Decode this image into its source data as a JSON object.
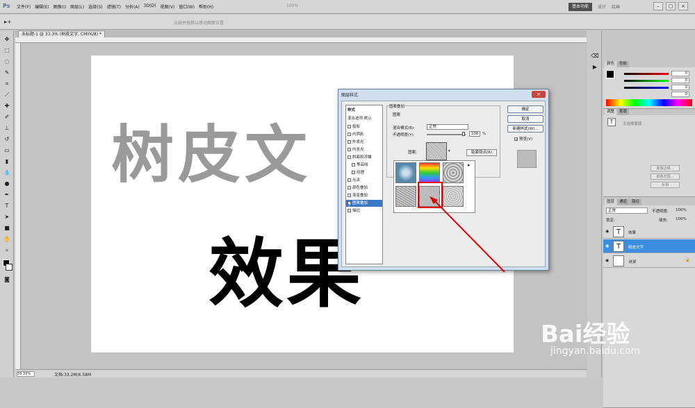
{
  "app": {
    "logo": "Ps",
    "workspace_label": "基本功能",
    "right_links": [
      "设计",
      "绘画"
    ],
    "zoom_display": "100%"
  },
  "menu": [
    "文件(F)",
    "编辑(E)",
    "图像(I)",
    "图层(L)",
    "选择(S)",
    "滤镜(T)",
    "分析(A)",
    "3D(D)",
    "视图(V)",
    "窗口(W)",
    "帮助(H)"
  ],
  "options": {
    "hint": "点按并拖移以移动图案位置"
  },
  "document": {
    "tab_title": "未标题-1 @ 33.3% (树皮文字, CMYK/8) *",
    "bark_text": "树皮文",
    "effect_text": "效果"
  },
  "status": {
    "zoom": "33.33%",
    "doc_info": "文档:33.2M/6.58M"
  },
  "dialog": {
    "title": "图层样式",
    "styles_header": "样式",
    "blend_options": "混合选项:默认",
    "items": [
      "投影",
      "内阴影",
      "外发光",
      "内发光",
      "斜面和浮雕",
      "等高线",
      "纹理",
      "光泽",
      "颜色叠加",
      "渐变叠加",
      "图案叠加",
      "描边"
    ],
    "selected_item": "图案叠加",
    "group_title": "图案叠加",
    "sub_title": "图案",
    "blend_mode_label": "混合模式(B):",
    "blend_mode_value": "正常",
    "opacity_label": "不透明度(Y):",
    "opacity_value": "100",
    "opacity_unit": "%",
    "opacity_fraction": 1.0,
    "pattern_label": "图案:",
    "snap_label": "贴紧原点(A)",
    "ok": "确定",
    "cancel": "取消",
    "new_style": "新建样式(W)...",
    "preview_label": "预览(V)"
  },
  "panels": {
    "color_tabs": [
      "颜色",
      "色板"
    ],
    "color_values": {
      "c": "0",
      "m": "0",
      "y": "0",
      "k": "0"
    },
    "char_tabs": [
      "调整",
      "蒙版"
    ],
    "char_note": "无选择蒙版",
    "char_buttons": [
      "蒙版边缘...",
      "颜色范围...",
      "反相"
    ],
    "layers_tabs": [
      "图层",
      "通道",
      "路径"
    ],
    "blend": "正常",
    "opacity_label": "不透明度:",
    "opacity_value": "100%",
    "lock_label": "锁定:",
    "fill_label": "填充:",
    "fill_value": "100%",
    "layers": [
      {
        "name": "效果",
        "thumb": "T"
      },
      {
        "name": "树皮文字",
        "thumb": "T"
      },
      {
        "name": "背景",
        "thumb": ""
      }
    ],
    "colors": {
      "accent": "#3d8ee0",
      "highlight": "#e00000"
    }
  },
  "watermark": {
    "main": "Bai经验",
    "sub": "jingyan.baidu.com"
  }
}
